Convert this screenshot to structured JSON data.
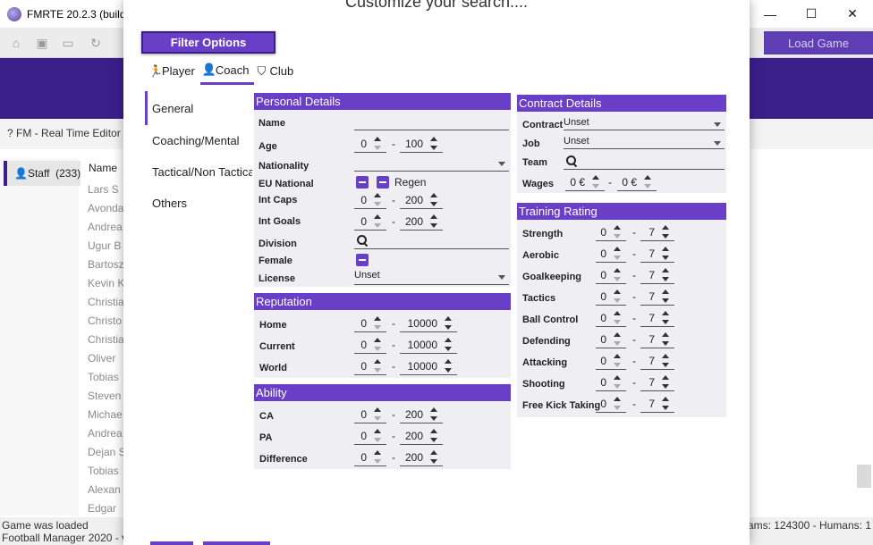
{
  "app": {
    "title": "FMRTE 20.2.3 (build",
    "minimize": "—",
    "maximize": "☐",
    "close": "✕",
    "load_game": "Load Game",
    "header_text": "FM - Real Time Editor",
    "staff_label": "Staff",
    "staff_count": "(233)",
    "name_col": "Name",
    "names": [
      "Lars S",
      "Avonda",
      "Andrea",
      "Ugur B",
      "Bartosz",
      "Kevin K",
      "Christia",
      "Christo",
      "Christia",
      "Oliver",
      "Tobias",
      "Steven",
      "Michae",
      "Andrea",
      "Dejan S",
      "Tobias",
      "Alexan",
      "Edgar"
    ],
    "status_line1": "Game was loaded",
    "status_line2": "Football Manager 2020 - v",
    "status_right": "eams: 124300 - Humans: 1"
  },
  "modal": {
    "title": "Customize your search....",
    "filter_button": "Filter Options",
    "tabs": [
      {
        "label": "Player",
        "icon": "player-icon",
        "glyph": "🏃"
      },
      {
        "label": "Coach",
        "icon": "coach-icon",
        "glyph": "👤"
      },
      {
        "label": "Club",
        "icon": "club-shield-icon",
        "glyph": "⛉"
      }
    ],
    "side_nav": [
      "General",
      "Coaching/Mental",
      "Tactical/Non Tactical",
      "Others"
    ]
  },
  "personal": {
    "title": "Personal Details",
    "name_label": "Name",
    "age_label": "Age",
    "age_min": "0",
    "age_max": "100",
    "nationality_label": "Nationality",
    "eu_label": "EU National",
    "regen_label": "Regen",
    "int_caps_label": "Int Caps",
    "int_caps_min": "0",
    "int_caps_max": "200",
    "int_goals_label": "Int Goals",
    "int_goals_min": "0",
    "int_goals_max": "200",
    "division_label": "Division",
    "female_label": "Female",
    "license_label": "License",
    "license_value": "Unset"
  },
  "reputation": {
    "title": "Reputation",
    "rows": [
      {
        "label": "Home",
        "min": "0",
        "max": "10000"
      },
      {
        "label": "Current",
        "min": "0",
        "max": "10000"
      },
      {
        "label": "World",
        "min": "0",
        "max": "10000"
      }
    ]
  },
  "ability": {
    "title": "Ability",
    "rows": [
      {
        "label": "CA",
        "min": "0",
        "max": "200"
      },
      {
        "label": "PA",
        "min": "0",
        "max": "200"
      },
      {
        "label": "Difference",
        "min": "0",
        "max": "200"
      }
    ]
  },
  "contract": {
    "title": "Contract Details",
    "contract_label": "Contract",
    "contract_value": "Unset",
    "job_label": "Job",
    "job_value": "Unset",
    "team_label": "Team",
    "wages_label": "Wages",
    "wages_min": "0 €",
    "wages_max": "0 €"
  },
  "training": {
    "title": "Training Rating",
    "rows": [
      {
        "label": "Strength",
        "min": "0",
        "max": "7"
      },
      {
        "label": "Aerobic",
        "min": "0",
        "max": "7"
      },
      {
        "label": "Goalkeeping",
        "min": "0",
        "max": "7"
      },
      {
        "label": "Tactics",
        "min": "0",
        "max": "7"
      },
      {
        "label": "Ball Control",
        "min": "0",
        "max": "7"
      },
      {
        "label": "Defending",
        "min": "0",
        "max": "7"
      },
      {
        "label": "Attacking",
        "min": "0",
        "max": "7"
      },
      {
        "label": "Shooting",
        "min": "0",
        "max": "7"
      },
      {
        "label": "Free Kick Taking",
        "min": "0",
        "max": "7"
      }
    ]
  },
  "range_dash": "-"
}
